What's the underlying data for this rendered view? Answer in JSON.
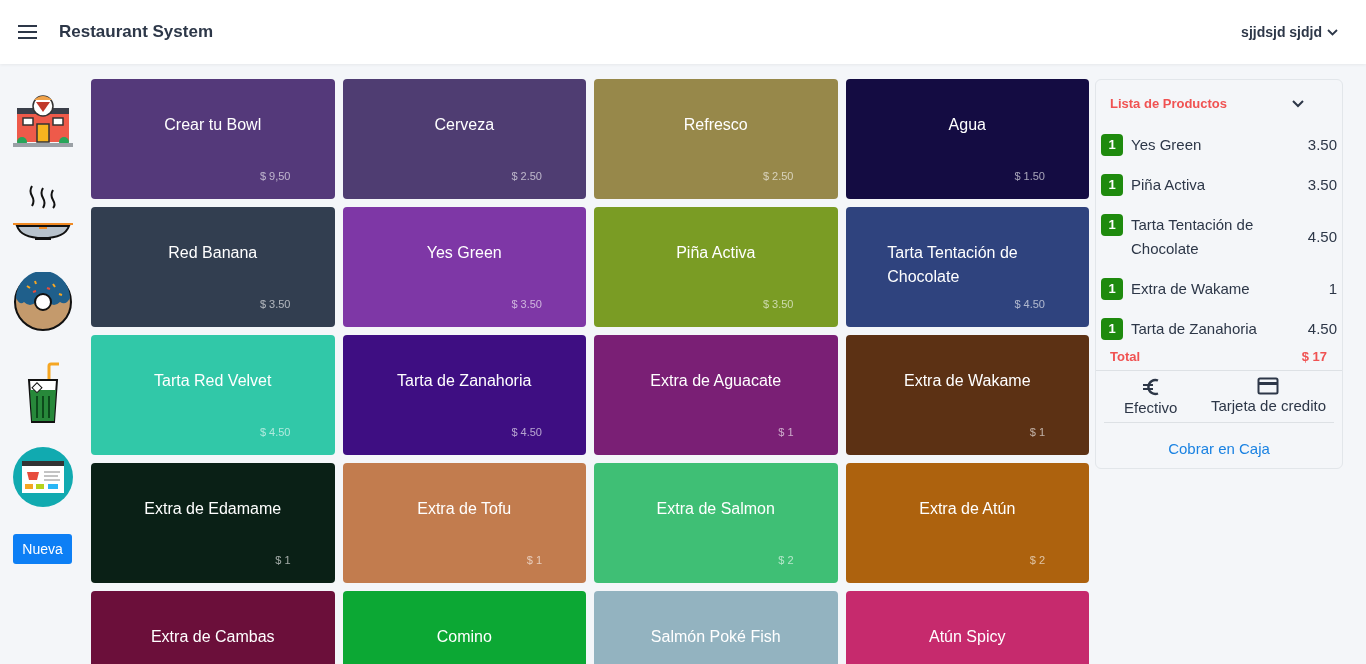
{
  "header": {
    "title": "Restaurant System",
    "user": "sjjdsjd sjdjd"
  },
  "new_button": "Nueva",
  "products": [
    {
      "name": "Crear tu Bowl",
      "price": "$ 9,50",
      "color": "#54397a"
    },
    {
      "name": "Cerveza",
      "price": "$ 2.50",
      "color": "#4f3d72"
    },
    {
      "name": "Refresco",
      "price": "$ 2.50",
      "color": "#97884a"
    },
    {
      "name": "Agua",
      "price": "$ 1.50",
      "color": "#140c42"
    },
    {
      "name": "Red Banana",
      "price": "$ 3.50",
      "color": "#323e50"
    },
    {
      "name": "Yes Green",
      "price": "$ 3.50",
      "color": "#7e37a6"
    },
    {
      "name": "Piña Activa",
      "price": "$ 3.50",
      "color": "#7a9c24"
    },
    {
      "name": "Tarta Tentación de Chocolate",
      "price": "$ 4.50",
      "color": "#2f437e"
    },
    {
      "name": "Tarta Red Velvet",
      "price": "$ 4.50",
      "color": "#31c8a8"
    },
    {
      "name": "Tarta de Zanahoria",
      "price": "$ 4.50",
      "color": "#3e0e82"
    },
    {
      "name": "Extra de Aguacate",
      "price": "$ 1",
      "color": "#7a1f75"
    },
    {
      "name": "Extra de Wakame",
      "price": "$ 1",
      "color": "#5c3114"
    },
    {
      "name": "Extra de Edamame",
      "price": "$ 1",
      "color": "#0a2016"
    },
    {
      "name": "Extra de Tofu",
      "price": "$ 1",
      "color": "#c27c4e"
    },
    {
      "name": "Extra de Salmon",
      "price": "$ 2",
      "color": "#3fbf75"
    },
    {
      "name": "Extra de Atún",
      "price": "$ 2",
      "color": "#ad620e"
    },
    {
      "name": "Extra de Cambas",
      "color": "#6b0f3a"
    },
    {
      "name": "Comino",
      "color": "#0ca834"
    },
    {
      "name": "Salmón Poké Fish",
      "color": "#93b3c0"
    },
    {
      "name": "Atún Spicy",
      "color": "#c62a6d"
    }
  ],
  "order": {
    "title": "Lista de Productos",
    "items": [
      {
        "qty": "1",
        "name": "Yes Green",
        "price": "3.50"
      },
      {
        "qty": "1",
        "name": "Piña Activa",
        "price": "3.50"
      },
      {
        "qty": "1",
        "name": "Tarta Tentación de Chocolate",
        "price": "4.50"
      },
      {
        "qty": "1",
        "name": "Extra de Wakame",
        "price": "1"
      },
      {
        "qty": "1",
        "name": "Tarta de Zanahoria",
        "price": "4.50"
      }
    ],
    "total_label": "Total",
    "total": "$ 17",
    "payments": [
      {
        "kind": "cash",
        "label": "Efectivo"
      },
      {
        "kind": "card",
        "label": "Tarjeta de credito"
      }
    ],
    "checkout": "Cobrar en Caja"
  }
}
